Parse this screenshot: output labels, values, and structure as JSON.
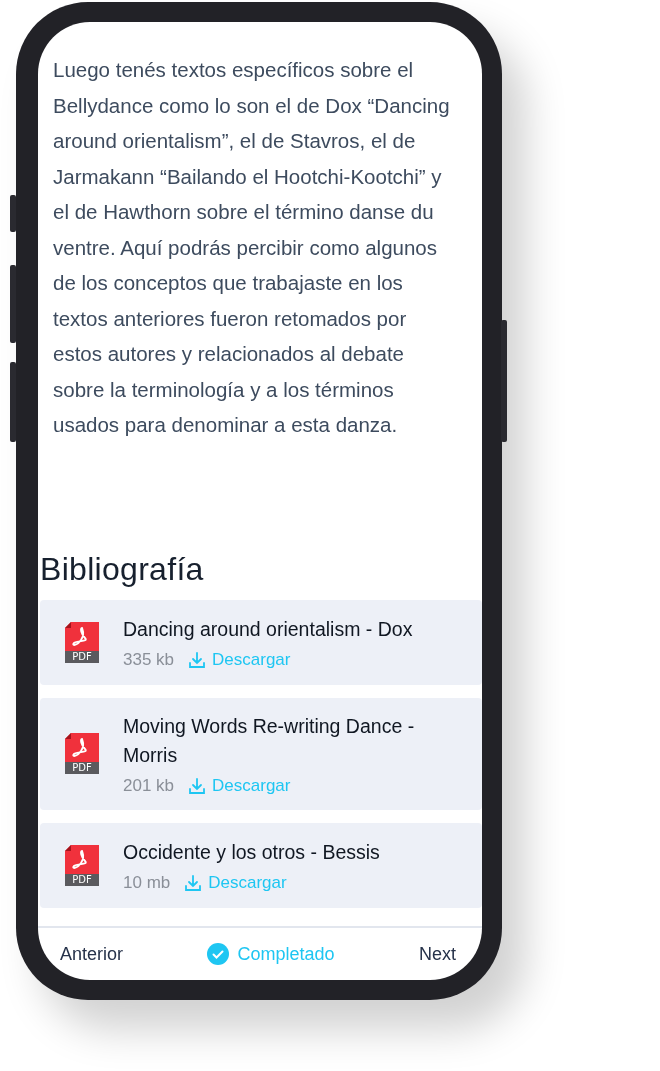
{
  "paragraph": "Luego tenés textos específicos sobre el Bellydance como lo son el de Dox “Dancing around orientalism”, el de Stavros, el de Jarmakann “Bailando el Hootchi-Kootchi” y el de Hawthorn sobre el término danse du ventre. Aquí podrás percibir como algunos de los conceptos que trabajaste en los textos anteriores fueron retomados por estos autores y relacionados al debate sobre la terminología y a los términos usados para denominar a esta danza.",
  "bibliography": {
    "title": "Bibliografía",
    "items": [
      {
        "file_type": "PDF",
        "title": "Dancing around orientalism - Dox",
        "size": "335 kb",
        "action": "Descargar"
      },
      {
        "file_type": "PDF",
        "title": "Moving Words Re-writing Dance - Morris",
        "size": "201 kb",
        "action": "Descargar"
      },
      {
        "file_type": "PDF",
        "title": "Occidente y los otros - Bessis",
        "size": "10 mb",
        "action": "Descargar"
      }
    ]
  },
  "footer": {
    "previous": "Anterior",
    "complete": {
      "label": "Completado",
      "completed": true
    },
    "next": "Next"
  }
}
